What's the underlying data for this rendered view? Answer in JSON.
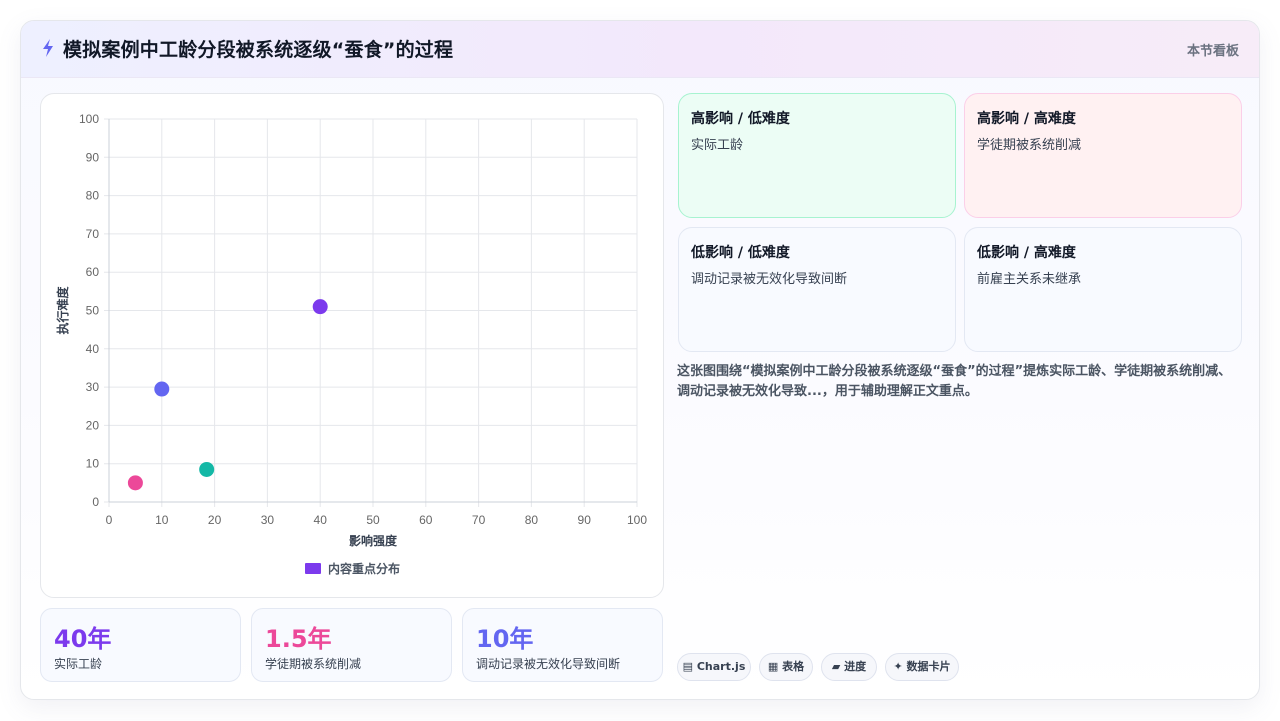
{
  "header": {
    "icon": "bolt-icon",
    "title": "模拟案例中工龄分段被系统逐级“蚕食”的过程",
    "tag": "本节看板"
  },
  "chart_data": {
    "type": "scatter",
    "xlabel": "影响强度",
    "ylabel": "执行难度",
    "xlim": [
      0,
      100
    ],
    "ylim": [
      0,
      100
    ],
    "xticks": [
      0,
      10,
      20,
      30,
      40,
      50,
      60,
      70,
      80,
      90,
      100
    ],
    "yticks": [
      0,
      10,
      20,
      30,
      40,
      50,
      60,
      70,
      80,
      90,
      100
    ],
    "grid": true,
    "legend_position": "bottom",
    "series": [
      {
        "name": "内容重点分布",
        "legend_color": "#7c3aed",
        "points": [
          {
            "x": 40,
            "y": 51,
            "color": "#7c3aed"
          },
          {
            "x": 10,
            "y": 29.5,
            "color": "#6366f1"
          },
          {
            "x": 18.5,
            "y": 8.5,
            "color": "#14b8a6"
          },
          {
            "x": 5,
            "y": 5,
            "color": "#ec4899"
          }
        ]
      }
    ]
  },
  "stats": [
    {
      "value": "40年",
      "label": "实际工龄",
      "color": "#7c3aed"
    },
    {
      "value": "1.5年",
      "label": "学徒期被系统削减",
      "color": "#ec4899"
    },
    {
      "value": "10年",
      "label": "调动记录被无效化导致间断",
      "color": "#6366f1"
    }
  ],
  "quadrants": [
    {
      "title": "高影响 / 低难度",
      "item": "实际工龄",
      "bg": "#ecfdf5",
      "border": "#a7f3d0"
    },
    {
      "title": "高影响 / 高难度",
      "item": "学徒期被系统削减",
      "bg": "#fff1f2",
      "border": "#fbcfe8"
    },
    {
      "title": "低影响 / 低难度",
      "item": "调动记录被无效化导致间断",
      "bg": "#f8faff",
      "border": "#e3e8f3"
    },
    {
      "title": "低影响 / 高难度",
      "item": "前雇主关系未继承",
      "bg": "#f8faff",
      "border": "#e3e8f3"
    }
  ],
  "description": "这张图围绕“模拟案例中工龄分段被系统逐级“蚕食”的过程”提炼实际工龄、学徒期被系统削减、调动记录被无效化导致...，用于辅助理解正文重点。",
  "chips": [
    {
      "icon": "chart-icon",
      "glyph": "▤",
      "label": "Chart.js"
    },
    {
      "icon": "table-icon",
      "glyph": "▦",
      "label": "表格"
    },
    {
      "icon": "progress-icon",
      "glyph": "▰",
      "label": "进度"
    },
    {
      "icon": "sparkle-icon",
      "glyph": "✦",
      "label": "数据卡片"
    }
  ]
}
